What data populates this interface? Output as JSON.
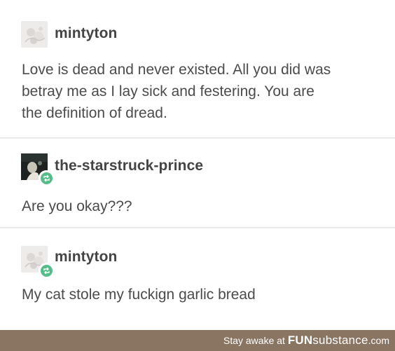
{
  "posts": [
    {
      "username": "mintyton",
      "message_lines": [
        "Love is dead and never existed. All you did was",
        "betray me as I lay sick and festering. You are",
        "the definition of dread."
      ],
      "avatar_icon": "pale-floral-avatar",
      "reblog": false
    },
    {
      "username": "the-starstruck-prince",
      "message_lines": [
        "Are you okay???"
      ],
      "avatar_icon": "dark-photo-avatar",
      "reblog": true
    },
    {
      "username": "mintyton",
      "message_lines": [
        "My cat stole my fuckign garlic bread"
      ],
      "avatar_icon": "pale-floral-avatar",
      "reblog": true
    }
  ],
  "footer": {
    "prefix": "Stay awake at ",
    "brand_bold": "FUN",
    "brand_light": "substance",
    "suffix": ".com"
  },
  "colors": {
    "reblog_green": "#56bc8a",
    "footer_bg": "#8a7462",
    "username": "#444444",
    "text": "#4b4b4b"
  }
}
